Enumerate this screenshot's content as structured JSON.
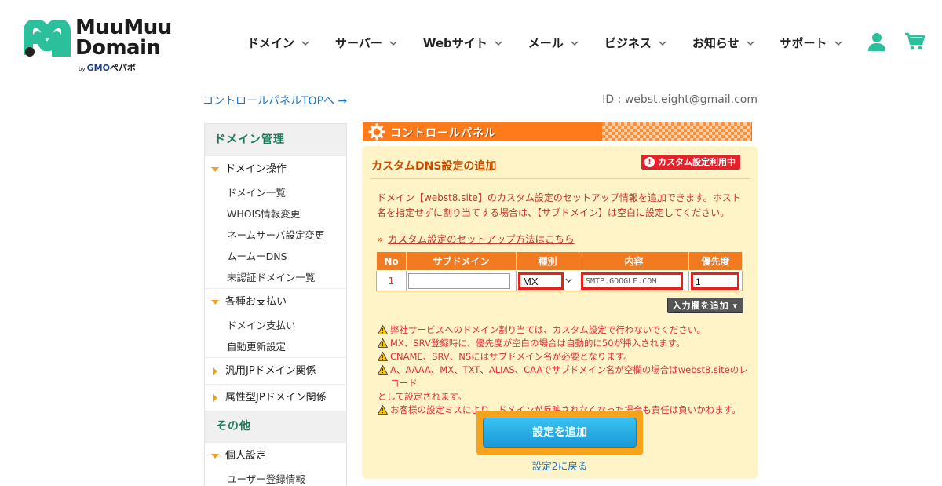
{
  "brand": {
    "line1": "MuuMuu",
    "line2": "Domain",
    "by": "by",
    "gmo": "GMO",
    "pepabo": "ペパボ",
    "mark_color": "#2bbf9b"
  },
  "nav": {
    "items": [
      {
        "label": "ドメイン"
      },
      {
        "label": "サーバー"
      },
      {
        "label": "Webサイト"
      },
      {
        "label": "メール"
      },
      {
        "label": "ビジネス"
      },
      {
        "label": "お知らせ"
      },
      {
        "label": "サポート"
      }
    ],
    "icons": [
      "user-icon",
      "cart-icon"
    ]
  },
  "top": {
    "cp_link": "コントロールパネルTOPへ →",
    "user_id": "ID : webst.eight@gmail.com"
  },
  "sidebar": {
    "domain_head": "ドメイン管理",
    "group_domain_ops": "ドメイン操作",
    "domain_ops_items": [
      "ドメイン一覧",
      "WHOIS情報変更",
      "ネームサーバ設定変更",
      "ムームーDNS",
      "未認証ドメイン一覧"
    ],
    "group_payments": "各種お支払い",
    "payments_items": [
      "ドメイン支払い",
      "自動更新設定"
    ],
    "group_jp": "汎用JPドメイン関係",
    "group_attr_jp": "属性型JPドメイン関係",
    "other_head": "その他",
    "group_personal": "個人設定",
    "personal_items": [
      "ユーザー登録情報"
    ]
  },
  "banner": {
    "title": "コントロールパネル"
  },
  "panel": {
    "title": "カスタムDNS設定の追加",
    "badge": "カスタム設定利用中",
    "badge_color": "#e8202a",
    "description": "ドメイン【webst8.site】のカスタム設定のセットアップ情報を追加できます。ホスト名を指定せずに割り当てする場合は、【サブドメイン】は空白に設定してください。",
    "howto_arrow": "»",
    "howto_link": "カスタム設定のセットアップ方法はこちら",
    "table": {
      "headers": [
        "No",
        "サブドメイン",
        "種別",
        "内容",
        "優先度"
      ],
      "row": {
        "no": "1",
        "subdomain": "",
        "type": "MX",
        "content": "SMTP.GOOGLE.COM",
        "priority": "1"
      }
    },
    "add_row_button": "入力欄を追加 ▾",
    "warnings": [
      "弊社サービスへのドメイン割り当ては、カスタム設定で行わないでください。",
      "MX、SRV登録時に、優先度が空白の場合は自動的に50が挿入されます。",
      "CNAME、SRV、NSにはサブドメイン名が必要となります。",
      "A、AAAA、MX、TXT、ALIAS、CAAでサブドメイン名が空欄の場合はwebst8.siteのレコード",
      "として設定されます。",
      "お客様の設定ミスにより、ドメインが反映されなくなった場合も責任は負いかねます。"
    ],
    "submit_button": "設定を追加",
    "back_link": "設定2に戻る"
  },
  "colors": {
    "accent_orange": "#f27b22",
    "panel_bg": "#fff4c8",
    "link_blue": "#1a73c8",
    "highlight_red": "#e8201a",
    "submit_frame": "#f7a21b",
    "submit_blue": "#1a9ad8"
  }
}
